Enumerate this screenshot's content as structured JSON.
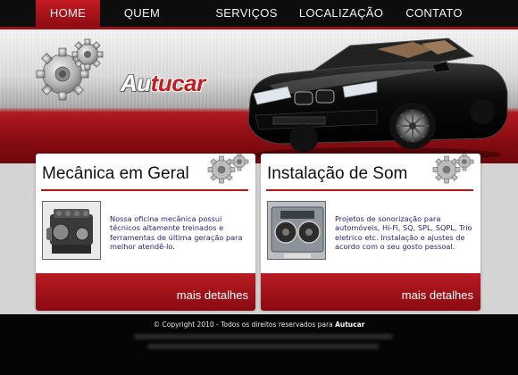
{
  "nav": {
    "items": [
      {
        "label": "HOME",
        "active": true
      },
      {
        "label": "QUEM SOMOS",
        "active": false
      },
      {
        "label": "SERVIÇOS",
        "active": false
      },
      {
        "label": "LOCALIZAÇÃO",
        "active": false
      },
      {
        "label": "CONTATO",
        "active": false
      }
    ]
  },
  "brand": {
    "logo_prefix": "Au",
    "logo_accent": "tucar",
    "accent_color": "#c41a22"
  },
  "panels": [
    {
      "title": "Mecânica em Geral",
      "text": "Nossa oficina mecânica possui técnicos altamente treinados e ferramentas de última geração para melhor atendê-lo.",
      "more": "mais detalhes",
      "image_icon": "engine-image"
    },
    {
      "title": "Instalação de Som",
      "text": "Projetos de sonorização para automóveis, Hi-Fi, SQ, SPL, SQPL, Trio eletrico etc. Instalação e ajustes de acordo com o seu gosto pessoal.",
      "more": "mais detalhes",
      "image_icon": "speaker-image"
    }
  ],
  "footer": {
    "copyright_prefix": "© Copyright 2010 - Todos os direitos reservados para ",
    "copyright_brand": "Autucar"
  }
}
